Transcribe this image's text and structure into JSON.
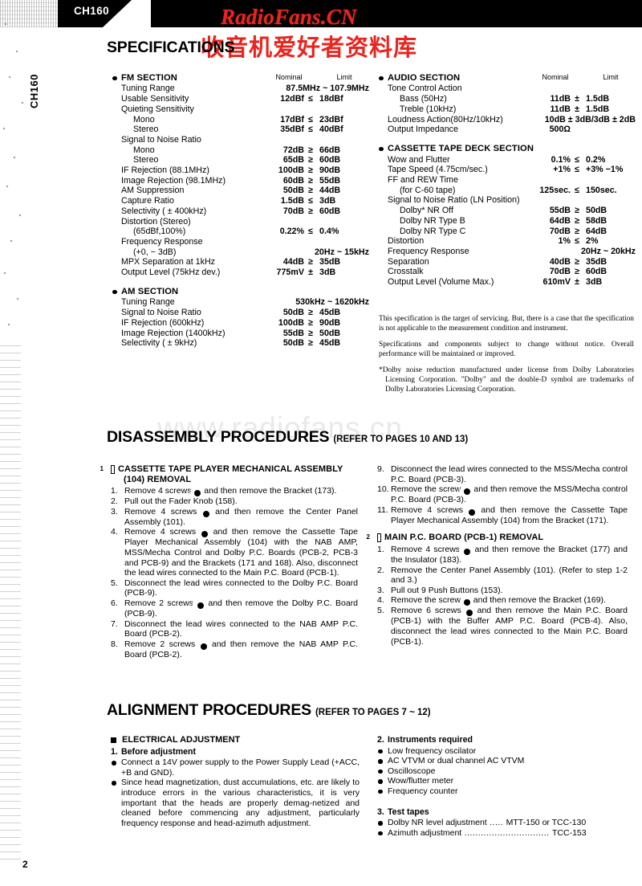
{
  "banner": {
    "model": "CH160",
    "spine_label": "CH160"
  },
  "watermarks": {
    "red_latin": "RadioFans.CN",
    "red_chinese": "收音机爱好者资料库",
    "faint": "www.radiofans.cn"
  },
  "headings": {
    "specification": "SPECIFICATIONS",
    "disassembly": "DISASSEMBLY PROCEDURES",
    "disassembly_refer": "(REFER TO PAGES 10 AND 13)",
    "alignment": "ALIGNMENT PROCEDURES",
    "alignment_refer": "(REFER TO PAGES 7 ~ 12)"
  },
  "column_headers": {
    "nominal": "Nominal",
    "limit": "Limit"
  },
  "spec": {
    "fm": {
      "title": "FM SECTION",
      "rows": [
        {
          "label": "Tuning Range",
          "indent": 0,
          "wide": "87.5MHz ~ 107.9MHz"
        },
        {
          "label": "Usable Sensitivity",
          "indent": 0,
          "nominal": "12dBf",
          "op": "≤",
          "limit": "18dBf"
        },
        {
          "label": "Quieting Sensitivity",
          "indent": 0,
          "nominal": "",
          "op": "",
          "limit": ""
        },
        {
          "label": "Mono",
          "indent": 1,
          "nominal": "17dBf",
          "op": "≤",
          "limit": "23dBf"
        },
        {
          "label": "Stereo",
          "indent": 1,
          "nominal": "35dBf",
          "op": "≤",
          "limit": "40dBf"
        },
        {
          "label": "Signal to Noise Ratio",
          "indent": 0,
          "nominal": "",
          "op": "",
          "limit": ""
        },
        {
          "label": "Mono",
          "indent": 1,
          "nominal": "72dB",
          "op": "≥",
          "limit": "66dB"
        },
        {
          "label": "Stereo",
          "indent": 1,
          "nominal": "65dB",
          "op": "≥",
          "limit": "60dB"
        },
        {
          "label": "IF Rejection (88.1MHz)",
          "indent": 0,
          "nominal": "100dB",
          "op": "≥",
          "limit": "90dB"
        },
        {
          "label": "Image Rejection (98.1MHz)",
          "indent": 0,
          "nominal": "60dB",
          "op": "≥",
          "limit": "55dB"
        },
        {
          "label": "AM Suppression",
          "indent": 0,
          "nominal": "50dB",
          "op": "≥",
          "limit": "44dB"
        },
        {
          "label": "Capture Ratio",
          "indent": 0,
          "nominal": "1.5dB",
          "op": "≤",
          "limit": "3dB"
        },
        {
          "label": "Selectivity ( ± 400kHz)",
          "indent": 0,
          "nominal": "70dB",
          "op": "≥",
          "limit": "60dB"
        },
        {
          "label": "Distortion (Stereo)",
          "indent": 0,
          "nominal": "",
          "op": "",
          "limit": ""
        },
        {
          "label": "(65dBf,100%)",
          "indent": 1,
          "nominal": "0.22%",
          "op": "≤",
          "limit": "0.4%"
        },
        {
          "label": "Frequency Response",
          "indent": 0,
          "nominal": "",
          "op": "",
          "limit": ""
        },
        {
          "label": "(+0,  − 3dB)",
          "indent": 1,
          "wide": "20Hz ~ 15kHz"
        },
        {
          "label": "MPX Separation at 1kHz",
          "indent": 0,
          "nominal": "44dB",
          "op": "≥",
          "limit": "35dB"
        },
        {
          "label": "Output Level (75kHz dev.)",
          "indent": 0,
          "nominal": "775mV",
          "op": "±",
          "limit": "3dB"
        }
      ]
    },
    "am": {
      "title": "AM SECTION",
      "rows": [
        {
          "label": "Tuning Range",
          "indent": 0,
          "wide": "530kHz ~ 1620kHz"
        },
        {
          "label": "Signal to Noise Ratio",
          "indent": 0,
          "nominal": "50dB",
          "op": "≥",
          "limit": "45dB"
        },
        {
          "label": "IF Rejection (600kHz)",
          "indent": 0,
          "nominal": "100dB",
          "op": "≥",
          "limit": "90dB"
        },
        {
          "label": "Image Rejection (1400kHz)",
          "indent": 0,
          "nominal": "55dB",
          "op": "≥",
          "limit": "50dB"
        },
        {
          "label": "Selectivity ( ± 9kHz)",
          "indent": 0,
          "nominal": "50dB",
          "op": "≥",
          "limit": "45dB"
        }
      ]
    },
    "audio": {
      "title": "AUDIO SECTION",
      "rows": [
        {
          "label": "Tone Control Action",
          "indent": 0,
          "nominal": "",
          "op": "",
          "limit": ""
        },
        {
          "label": "Bass (50Hz)",
          "indent": 1,
          "nominal": "11dB",
          "op": "±",
          "limit": "1.5dB"
        },
        {
          "label": "Treble (10kHz)",
          "indent": 1,
          "nominal": "11dB",
          "op": "±",
          "limit": "1.5dB"
        },
        {
          "label": "Loudness Action(80Hz/10kHz)",
          "indent": 0,
          "wide": "10dB ± 3dB/3dB ± 2dB"
        },
        {
          "label": "Output Impedance",
          "indent": 0,
          "nominal": "500Ω",
          "op": "",
          "limit": ""
        }
      ]
    },
    "cassette": {
      "title": "CASSETTE TAPE DECK SECTION",
      "rows": [
        {
          "label": "Wow and Flutter",
          "indent": 0,
          "nominal": "0.1%",
          "op": "≤",
          "limit": "0.2%"
        },
        {
          "label": "Tape Speed (4.75cm/sec.)",
          "indent": 0,
          "nominal": "+1%",
          "op": "≤",
          "limit": "+3%  −1%"
        },
        {
          "label": "FF and REW Time",
          "indent": 0,
          "nominal": "",
          "op": "",
          "limit": ""
        },
        {
          "label": "(for C-60 tape)",
          "indent": 1,
          "nominal": "125sec.",
          "op": "≤",
          "limit": "150sec."
        },
        {
          "label": "Signal to Noise Ratio (LN Position)",
          "indent": 0,
          "nominal": "",
          "op": "",
          "limit": ""
        },
        {
          "label": "Dolby* NR Off",
          "indent": 1,
          "nominal": "55dB",
          "op": "≥",
          "limit": "50dB"
        },
        {
          "label": "Dolby NR Type B",
          "indent": 1,
          "nominal": "64dB",
          "op": "≥",
          "limit": "58dB"
        },
        {
          "label": "Dolby NR Type C",
          "indent": 1,
          "nominal": "70dB",
          "op": "≥",
          "limit": "64dB"
        },
        {
          "label": "Distortion",
          "indent": 0,
          "nominal": "1%",
          "op": "≤",
          "limit": "2%"
        },
        {
          "label": "Frequency Response",
          "indent": 0,
          "wide": "20Hz ~ 20kHz"
        },
        {
          "label": "Separation",
          "indent": 0,
          "nominal": "40dB",
          "op": "≥",
          "limit": "35dB"
        },
        {
          "label": "Crosstalk",
          "indent": 0,
          "nominal": "70dB",
          "op": "≥",
          "limit": "60dB"
        },
        {
          "label": "Output Level (Volume Max.)",
          "indent": 0,
          "nominal": "610mV",
          "op": "±",
          "limit": "3dB"
        }
      ]
    }
  },
  "notes": {
    "note1": "This specification is the target of servicing. But, there is a case that the specification is not applicable to the measurement condition and instrument.",
    "note2": "Specifications and components subject to change without notice. Overall performance will be maintained or improved.",
    "note3": "*Dolby noise reduction manufactured under license from Dolby Laboratories Licensing Corporation. \"Dolby\" and the double-D symbol are trademarks of Dolby Laboratories Licensing Corporation."
  },
  "disassembly": {
    "group1": {
      "number": "1",
      "title": "CASSETTE TAPE PLAYER MECHANICAL ASSEMBLY (104) REMOVAL",
      "steps": [
        {
          "n": "1.",
          "pre": "Remove 4 screws",
          "screw": "A",
          "post": "and then remove the Bracket (173)."
        },
        {
          "n": "2.",
          "pre": "Pull out the Fader Knob (158).",
          "screw": "",
          "post": ""
        },
        {
          "n": "3.",
          "pre": "Remove 4 screws",
          "screw": "B",
          "post": "and then remove the Center Panel Assembly (101)."
        },
        {
          "n": "4.",
          "pre": "Remove 4 screws",
          "screw": "C",
          "post": "and then remove the Cassette Tape Player Mechanical Assembly (104) with the NAB AMP, MSS/Mecha Control and Dolby P.C. Boards (PCB-2, PCB-3 and PCB-9) and the Brackets (171 and 168). Also, disconnect the lead wires connected to the Main P.C. Board (PCB-1)."
        },
        {
          "n": "5.",
          "pre": "Disconnect the lead wires connected to the Dolby P.C. Board (PCB-9).",
          "screw": "",
          "post": ""
        },
        {
          "n": "6.",
          "pre": "Remove 2 screws",
          "screw": "D",
          "post": "and then remove the Dolby P.C. Board (PCB-9)."
        },
        {
          "n": "7.",
          "pre": "Disconnect the lead wires connected to the NAB AMP P.C. Board (PCB-2).",
          "screw": "",
          "post": ""
        },
        {
          "n": "8.",
          "pre": "Remove 2 screws",
          "screw": "E",
          "post": "and then remove the NAB AMP P.C. Board (PCB-2)."
        },
        {
          "n": "9.",
          "pre": "Disconnect the lead wires connected to the MSS/Mecha control P.C. Board (PCB-3).",
          "screw": "",
          "post": ""
        },
        {
          "n": "10.",
          "pre": "Remove the screw",
          "screw": "F",
          "post": "and then remove the MSS/Mecha control P.C. Board (PCB-3)."
        },
        {
          "n": "11.",
          "pre": "Remove 4 screws",
          "screw": "G",
          "post": "and then remove the Cassette Tape Player Mechanical Assembly (104) from the Bracket (171)."
        }
      ]
    },
    "group2": {
      "number": "2",
      "title": "MAIN P.C. BOARD (PCB-1) REMOVAL",
      "steps": [
        {
          "n": "1.",
          "pre": "Remove 4 screws",
          "screw": "H",
          "post": "and then remove the Bracket (177) and the Insulator (183)."
        },
        {
          "n": "2.",
          "pre": "Remove the Center Panel Assembly (101). (Refer to step 1-2 and 3.)",
          "screw": "",
          "post": ""
        },
        {
          "n": "3.",
          "pre": "Pull out 9 Push Buttons (153).",
          "screw": "",
          "post": ""
        },
        {
          "n": "4.",
          "pre": "Remove the screw",
          "screw": "I",
          "post": "and then remove the Bracket (169)."
        },
        {
          "n": "5.",
          "pre": "Remove 6 screws",
          "screw": "J",
          "post": "and then remove the Main P.C. Board (PCB-1) with the Buffer AMP P.C. Board (PCB-4). Also, disconnect the lead wires connected to the Main P.C. Board (PCB-1)."
        }
      ]
    }
  },
  "alignment": {
    "electrical_title": "ELECTRICAL ADJUSTMENT",
    "before": {
      "n": "1.",
      "title": "Before adjustment",
      "items": [
        "Connect a 14V power supply to the Power Supply Lead (+ACC, +B and GND).",
        "Since head magnetization, dust accumulations, etc. are likely to introduce errors in the various characteristics, it is very important that the heads are properly demag-netized and cleaned before commencing any adjustment, particularly frequency response and head-azimuth adjustment."
      ]
    },
    "instruments": {
      "n": "2.",
      "title": "Instruments required",
      "items": [
        "Low frequency oscilator",
        "AC VTVM or dual channel AC VTVM",
        "Oscilloscope",
        "Wow/flutter meter",
        "Frequency counter"
      ]
    },
    "test_tapes": {
      "n": "3.",
      "title": "Test tapes",
      "items": [
        {
          "label": "Dolby NR level adjustment",
          "dots": " ..... ",
          "value": "MTT-150 or TCC-130"
        },
        {
          "label": "Azimuth adjustment",
          "dots": " ............................... ",
          "value": "TCC-153"
        }
      ]
    }
  },
  "footer": {
    "page_number": "2"
  },
  "colors": {
    "red": "#e8251f",
    "black": "#000000",
    "paper": "#ffffff"
  }
}
